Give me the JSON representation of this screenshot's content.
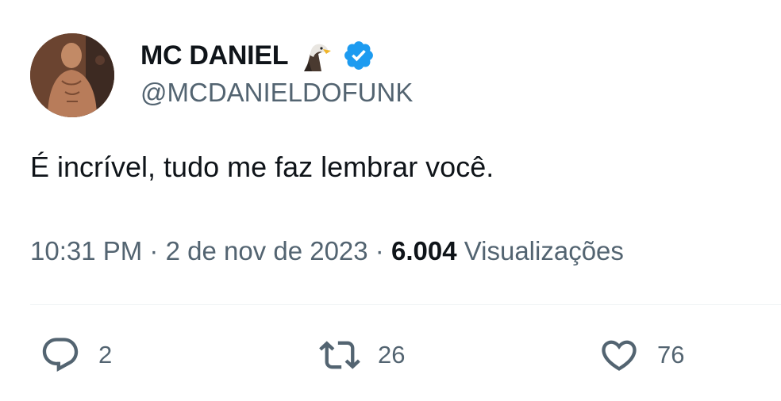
{
  "author": {
    "display_name": "MC DANIEL",
    "emoji": "eagle-emoji",
    "verified": true,
    "handle": "@MCDANIELDOFUNK",
    "avatar": "profile-photo"
  },
  "tweet": {
    "text": "É incrível, tudo me faz lembrar você."
  },
  "meta": {
    "time": "10:31 PM",
    "separator": " · ",
    "date": "2 de nov de 2023",
    "views_count": "6.004",
    "views_label": " Visualizações"
  },
  "actions": {
    "reply": {
      "icon": "reply-icon",
      "count": "2"
    },
    "retweet": {
      "icon": "retweet-icon",
      "count": "26"
    },
    "like": {
      "icon": "heart-icon",
      "count": "76"
    }
  },
  "colors": {
    "text_primary": "#0f1419",
    "text_secondary": "#536471",
    "verified_blue": "#1d9bf0",
    "divider": "#eff3f4"
  }
}
